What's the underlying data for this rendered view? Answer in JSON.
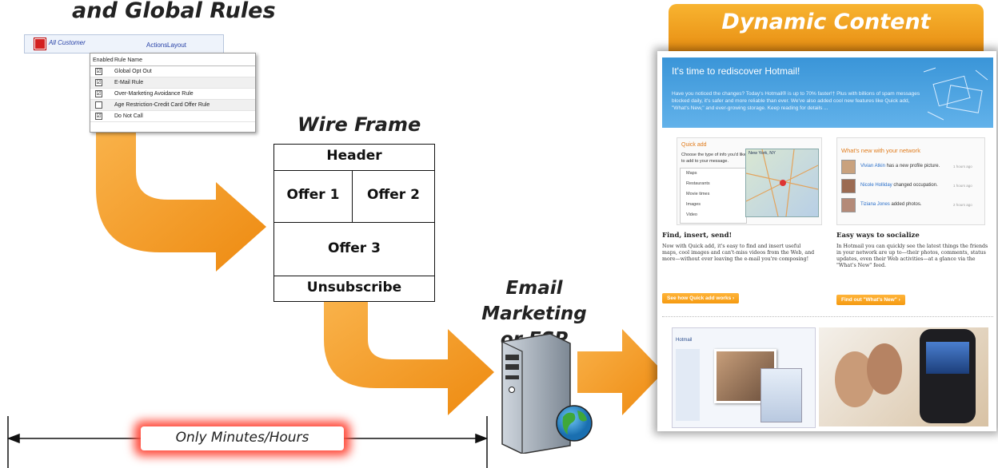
{
  "global_rules": {
    "title": "and Global Rules",
    "customer_link": "All Customer",
    "actions": "Actions",
    "layout": "Layout",
    "col_enabled": "Enabled",
    "col_rule_name": "Rule Name",
    "rules": [
      {
        "name": "Global Opt Out",
        "checked": "☑"
      },
      {
        "name": "E-Mail Rule",
        "checked": "☑"
      },
      {
        "name": "Over-Marketing Avoidance Rule",
        "checked": "☑"
      },
      {
        "name": "Age Restriction-Credit Card Offer Rule",
        "checked": ""
      },
      {
        "name": "Do Not Call",
        "checked": "☑"
      }
    ]
  },
  "wire_frame": {
    "title": "Wire Frame",
    "header": "Header",
    "offer1": "Offer 1",
    "offer2": "Offer 2",
    "offer3": "Offer 3",
    "unsubscribe": "Unsubscribe"
  },
  "esp": {
    "title_line1": "Email Marketing",
    "title_line2": "or ESP"
  },
  "dynamic_content": {
    "title": "Dynamic Content",
    "headline": "It's time to rediscover Hotmail!",
    "intro": "Have you noticed the changes? Today's Hotmail® is up to 70% faster!† Plus with billions of spam messages blocked daily, it's safer and more reliable than ever. We've also added cool new features like Quick add, \"What's New,\" and ever-growing storage. Keep reading for details ...",
    "quick_add": {
      "label": "Quick add",
      "prompt": "Choose the type of info you'd like to add to your message.",
      "items": [
        "Maps",
        "Restaurants",
        "Movie times",
        "Images",
        "Video"
      ],
      "map_label": "New York, NY"
    },
    "whats_new": {
      "label": "What's new with your network",
      "items": [
        {
          "who": "Vivian Atkin",
          "what": "has a new profile picture.",
          "when": "1 hours ago"
        },
        {
          "who": "Nicole Holliday",
          "what": "changed occupation.",
          "when": "1 hours ago"
        },
        {
          "who": "Tiziana Jones",
          "what": "added photos.",
          "when": "2 hours ago"
        }
      ]
    },
    "find_title": "Find, insert, send!",
    "find_body": "Now with Quick add, it's easy to find and insert useful maps, cool images and can't-miss videos from the Web, and more—without ever leaving the e-mail you're composing!",
    "find_btn": "See how Quick add works ›",
    "social_title": "Easy ways to socialize",
    "social_body": "In Hotmail you can quickly see the latest things the friends in your network are up to—their photos, comments, status updates, even their Web activities—at a glance via the \"What's New\" feed.",
    "social_btn": "Find out \"What's New\" ›",
    "mini_app": "Hotmail"
  },
  "timeline": {
    "label": "Only Minutes/Hours"
  },
  "colors": {
    "arrow": "#f39a1e",
    "banner": "#f0a020",
    "hotmail_blue": "#3a95d8",
    "glow": "#ff4a3a"
  }
}
